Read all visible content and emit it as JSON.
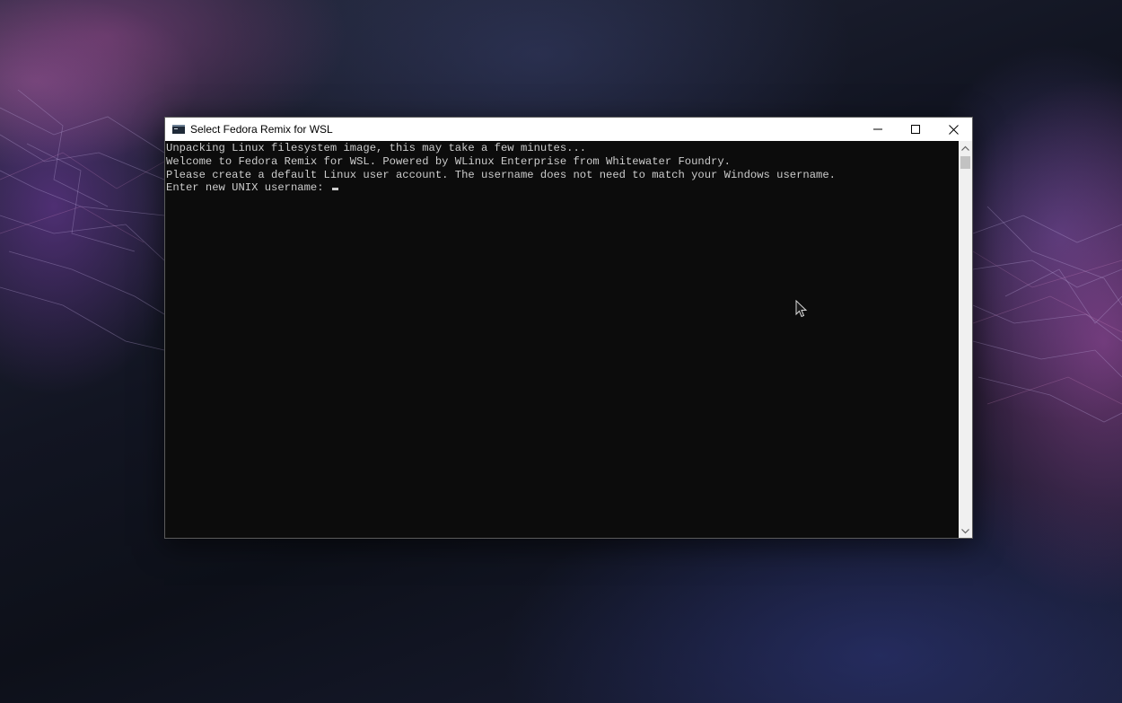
{
  "window": {
    "title": "Select Fedora Remix for WSL",
    "icon": "console-icon",
    "controls": [
      "minimize-icon",
      "maximize-icon",
      "close-icon"
    ]
  },
  "console": {
    "lines": [
      "Unpacking Linux filesystem image, this may take a few minutes...",
      "Welcome to Fedora Remix for WSL. Powered by WLinux Enterprise from Whitewater Foundry.",
      "Please create a default Linux user account. The username does not need to match your Windows username."
    ],
    "prompt": "Enter new UNIX username: ",
    "input_value": ""
  },
  "colors": {
    "console_background": "#0c0c0c",
    "console_text": "#cccccc",
    "titlebar": "#ffffff"
  }
}
